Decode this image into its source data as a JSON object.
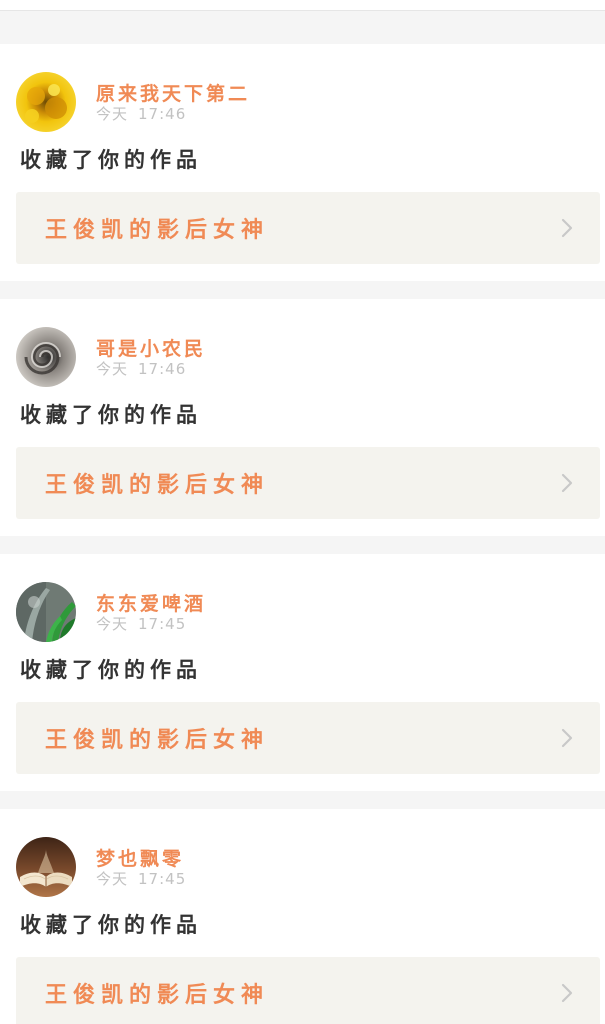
{
  "feed": {
    "items": [
      {
        "username": "原来我天下第二",
        "date": "今天",
        "time": "17:46",
        "action": "收藏了你的作品",
        "work_title": "王俊凯的影后女神",
        "avatar_icon": "sunflower-avatar"
      },
      {
        "username": "哥是小农民",
        "date": "今天",
        "time": "17:46",
        "action": "收藏了你的作品",
        "work_title": "王俊凯的影后女神",
        "avatar_icon": "swirl-avatar"
      },
      {
        "username": "东东爱啤酒",
        "date": "今天",
        "time": "17:45",
        "action": "收藏了你的作品",
        "work_title": "王俊凯的影后女神",
        "avatar_icon": "plant-avatar"
      },
      {
        "username": "梦也飘零",
        "date": "今天",
        "time": "17:45",
        "action": "收藏了你的作品",
        "work_title": "王俊凯的影后女神",
        "avatar_icon": "open-book-avatar"
      }
    ]
  },
  "colors": {
    "accent": "#f08a55",
    "link_background": "#f4f3ee",
    "page_background": "#f5f5f5"
  }
}
